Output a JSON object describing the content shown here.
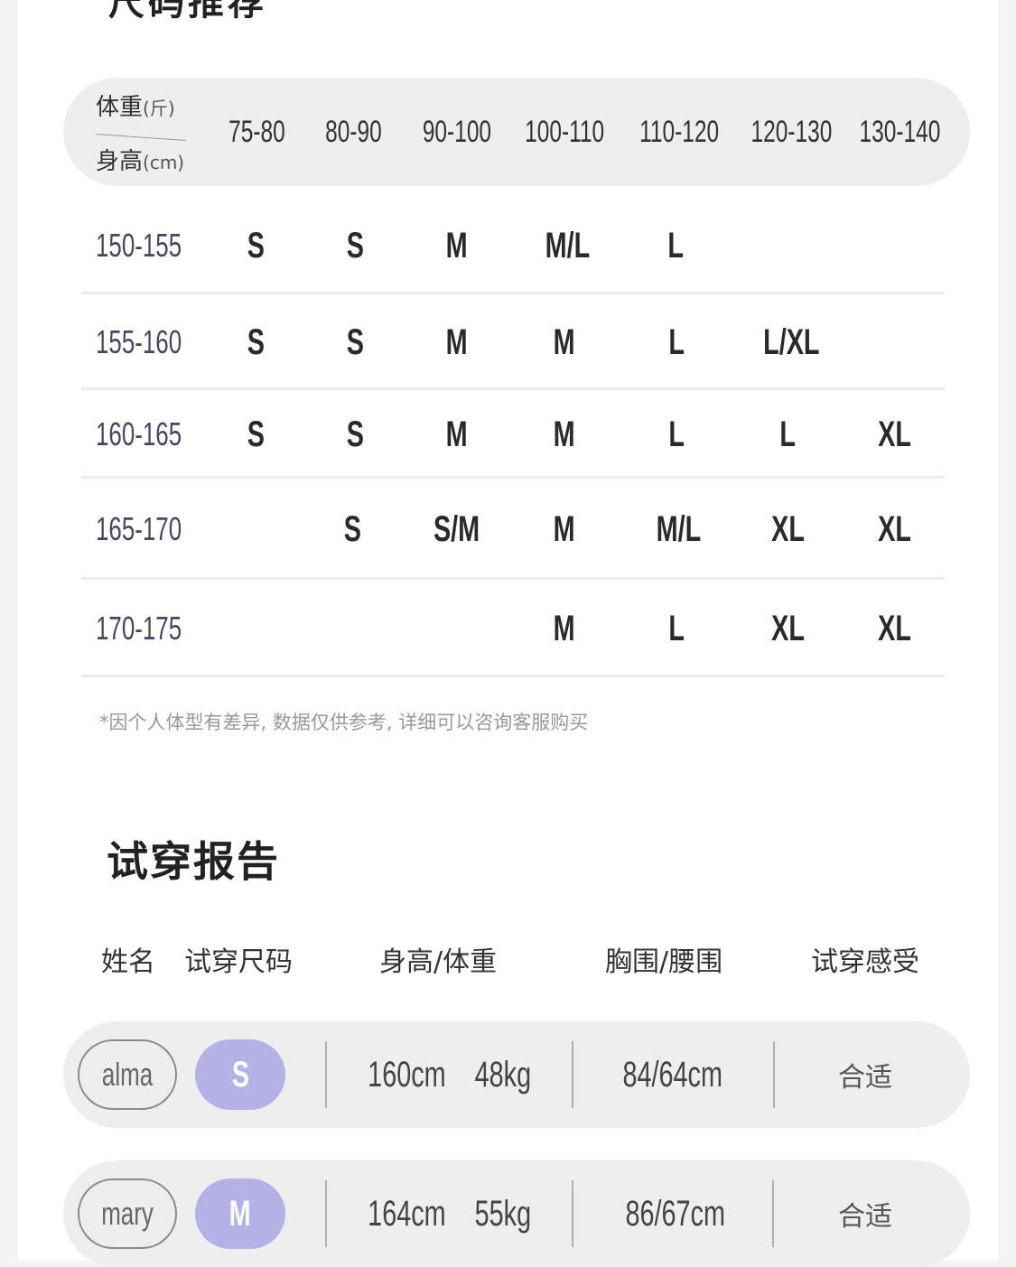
{
  "size_chart": {
    "title": "尺码推荐",
    "corner": {
      "weight_label": "体重",
      "weight_unit": "(斤)",
      "height_label": "身高",
      "height_unit": "(cm)"
    },
    "weight_columns": [
      "75-80",
      "80-90",
      "90-100",
      "100-110",
      "110-120",
      "120-130",
      "130-140"
    ],
    "rows": [
      {
        "height": "150-155",
        "sizes": [
          "S",
          "S",
          "M",
          "M/L",
          "L",
          "",
          ""
        ]
      },
      {
        "height": "155-160",
        "sizes": [
          "S",
          "S",
          "M",
          "M",
          "L",
          "L/XL",
          ""
        ]
      },
      {
        "height": "160-165",
        "sizes": [
          "S",
          "S",
          "M",
          "M",
          "L",
          "L",
          "XL"
        ]
      },
      {
        "height": "165-170",
        "sizes": [
          "",
          "S",
          "S/M",
          "M",
          "M/L",
          "XL",
          "XL"
        ]
      },
      {
        "height": "170-175",
        "sizes": [
          "",
          "",
          "",
          "M",
          "L",
          "XL",
          "XL"
        ]
      }
    ],
    "note": "*因个人体型有差异, 数据仅供参考, 详细可以咨询客服购买"
  },
  "trial_report": {
    "title": "试穿报告",
    "columns": {
      "name": "姓名",
      "size": "试穿尺码",
      "height_weight": "身高/体重",
      "bust_waist": "胸围/腰围",
      "feel": "试穿感受"
    },
    "entries": [
      {
        "name": "alma",
        "size": "S",
        "height": "160cm",
        "weight": "48kg",
        "bust_waist": "84/64cm",
        "feel": "合适"
      },
      {
        "name": "mary",
        "size": "M",
        "height": "164cm",
        "weight": "55kg",
        "bust_waist": "86/67cm",
        "feel": "合适"
      }
    ]
  },
  "colors": {
    "size_pill": "#b5b0e6",
    "row_label": "#4a4560",
    "pill_bg": "#eeeeee"
  }
}
